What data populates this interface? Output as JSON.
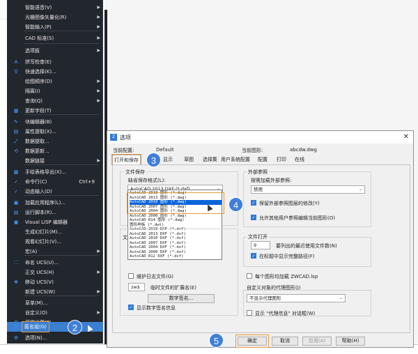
{
  "menu": {
    "items": [
      {
        "label": "智能语音(V)",
        "icon": "",
        "arrow": true
      },
      {
        "label": "光栅图像矢量化(R)",
        "icon": "",
        "arrow": true
      },
      {
        "label": "智能输入(P)",
        "icon": "",
        "arrow": true
      },
      {
        "label": "CAD 标准(S)",
        "icon": "",
        "arrow": true
      },
      {
        "label": "选项板",
        "icon": "",
        "arrow": true
      },
      {
        "label": "拼写检查(E)",
        "icon": "A",
        "arrow": false
      },
      {
        "label": "快速选择(K)...",
        "icon": "⚲",
        "arrow": false
      },
      {
        "label": "绘图顺序(D)",
        "icon": "",
        "arrow": true
      },
      {
        "label": "隔离(I)",
        "icon": "",
        "arrow": true
      },
      {
        "label": "查询(Q)",
        "icon": "",
        "arrow": true
      },
      {
        "label": "更新字段(T)",
        "icon": "▦",
        "arrow": false
      },
      {
        "label": "块编辑器(B)",
        "icon": "✎",
        "arrow": false
      },
      {
        "label": "属性提取(X)...",
        "icon": "▤",
        "arrow": false
      },
      {
        "label": "数据提取...",
        "icon": "⤢",
        "arrow": false
      },
      {
        "label": "数据更新...",
        "icon": "⟲",
        "arrow": false
      },
      {
        "label": "数据链接",
        "icon": "",
        "arrow": true
      },
      {
        "label": "手绘表格导出(X)...",
        "icon": "▦",
        "arrow": false
      },
      {
        "label": "命令行(C)",
        "icon": "✓",
        "arrow": false,
        "shortcut": "Ctrl+9"
      },
      {
        "label": "动态输入(D)",
        "icon": "✓",
        "arrow": false
      },
      {
        "label": "加载应用程序(L)...",
        "icon": "▣",
        "arrow": false
      },
      {
        "label": "运行脚本(R)...",
        "icon": "▤",
        "arrow": false
      },
      {
        "label": "Visual LISP 编辑器",
        "icon": "▣",
        "arrow": false
      },
      {
        "label": "生成幻灯片(M)...",
        "icon": "",
        "arrow": false
      },
      {
        "label": "观看幻灯片(V)...",
        "icon": "",
        "arrow": false
      },
      {
        "label": "宏(A)",
        "icon": "",
        "arrow": true
      },
      {
        "label": "命名 UCS(U)...",
        "icon": "⛶",
        "arrow": false
      },
      {
        "label": "正交 UCS(H)",
        "icon": "",
        "arrow": true
      },
      {
        "label": "移动 UCS(V)",
        "icon": "✥",
        "arrow": false
      },
      {
        "label": "新建 UCS(W)",
        "icon": "",
        "arrow": true
      },
      {
        "label": "草单(M)...",
        "icon": "",
        "arrow": false
      },
      {
        "label": "自定义(O)",
        "icon": "",
        "arrow": true
      },
      {
        "label": "草图设置(F)...",
        "icon": "⚙",
        "arrow": false
      },
      {
        "label": "匿名组(G)",
        "icon": "⚐",
        "arrow": false
      },
      {
        "label": "选项(N)...",
        "icon": "⚙",
        "arrow": false
      },
      {
        "label": "工具栏",
        "icon": "",
        "arrow": false
      }
    ]
  },
  "dialog": {
    "title": "选项",
    "current_profile_label": "当前配置:",
    "current_profile": "Default",
    "current_drawing_label": "当前图形:",
    "current_drawing": "abcdw.dwg",
    "tabs": [
      "打开和保存",
      "显示",
      "草图",
      "选择集",
      "用户系统配置",
      "配置",
      "打印",
      "在线"
    ],
    "file_save_group": "文件保存",
    "default_save_format_label": "缺省保存格式(L):",
    "save_format_value": "AutoCAD 2013 DXF (*.dxf)",
    "format_options": [
      "AutoCAD 2018 图形 (*.dwg)",
      "AutoCAD 2013 图形 (*.dwg)",
      "AutoCAD 2010 图形 (*.dwg)",
      "AutoCAD 2007 图形 (*.dwg)",
      "AutoCAD 2004 图形 (*.dwg)",
      "AutoCAD 2000 图形 (*.dwg)",
      "AutoCAD R14 图形 (*.dwg)",
      "图形样板 (*.dwt)",
      "AutoCAD 2018 DXF (*.dxf)",
      "AutoCAD 2013 DXF (*.dxf)",
      "AutoCAD 2010 DXF (*.dxf)",
      "AutoCAD 2007 DXF (*.dxf)",
      "AutoCAD 2004 DXF (*.dxf)",
      "AutoCAD 2000 DXF (*.dxf)",
      "AutoCAD R12 DXF (*.dxf)"
    ],
    "file_safety_partial": "文",
    "maintain_log": "维护日志文件(G)",
    "temp_ext_value": "zw$",
    "temp_ext_label": "临时文件的扩展名(E)",
    "digital_sign_btn": "数字签名...",
    "show_sign_info": "显示数字签名信息",
    "xref_group": "外部参照",
    "load_xref_label": "按需加载外部参照:",
    "load_xref_value": "禁用",
    "keep_layer_changes": "保留外部参照图层的修改(Y)",
    "allow_edit": "允许其他用户参照编辑当前图形(O)",
    "file_open_group": "文件打开",
    "recent_count": "9",
    "recent_label": "要列出的最近使用文件数(N)",
    "show_full_path": "在标题中显示完整路径(F)",
    "load_lsp": "每个图形均加载 ZWCAD.lsp",
    "proxy_group": "自定义对象的代理图形(J)",
    "proxy_value": "不显示代理图形",
    "show_proxy_dialog": "显示 \"代理信息\" 对话框(W)",
    "buttons": {
      "ok": "确定",
      "cancel": "取消",
      "apply": "应用(A)",
      "help": "帮助(H)"
    }
  },
  "badges": [
    "2",
    "3",
    "4",
    "5"
  ]
}
